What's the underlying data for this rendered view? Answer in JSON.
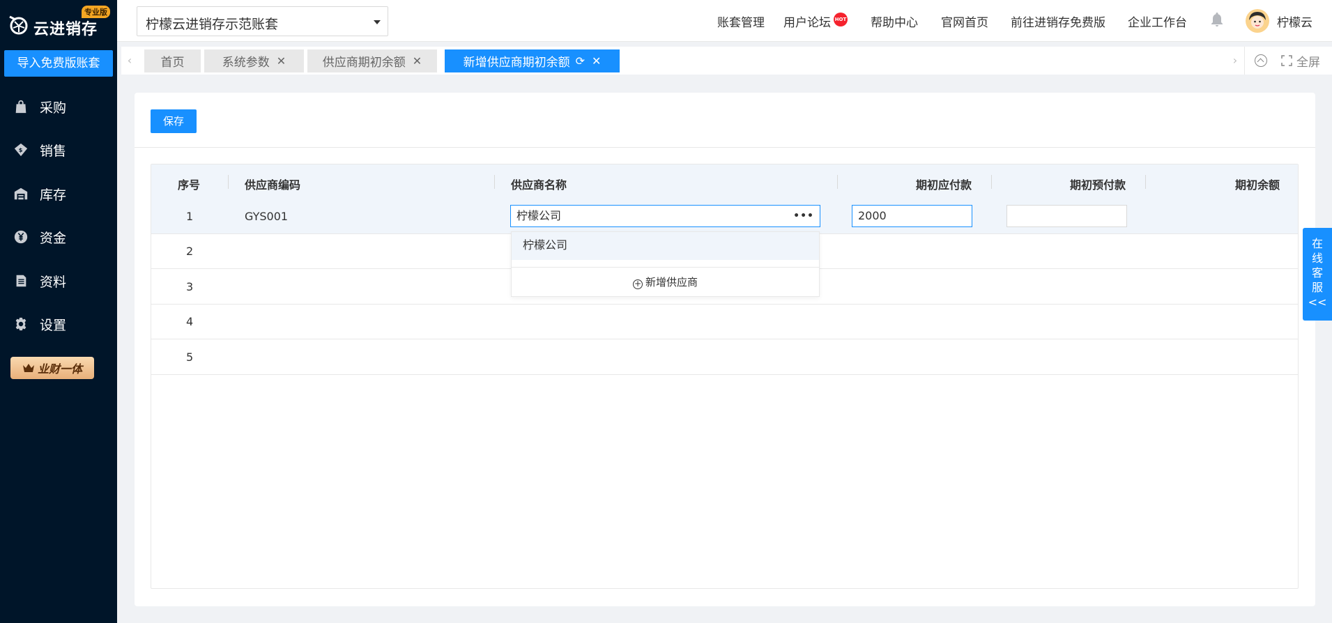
{
  "brand": {
    "logo_text": "云进销存",
    "badge": "专业版"
  },
  "sidebar": {
    "import_button": "导入免费版账套",
    "items": [
      {
        "label": "采购",
        "icon": "bag-icon"
      },
      {
        "label": "销售",
        "icon": "sales-icon"
      },
      {
        "label": "库存",
        "icon": "warehouse-icon"
      },
      {
        "label": "资金",
        "icon": "yen-icon"
      },
      {
        "label": "资料",
        "icon": "document-icon"
      },
      {
        "label": "设置",
        "icon": "gear-icon"
      }
    ],
    "promo": "业财一体"
  },
  "header": {
    "account_value": "柠檬云进销存示范账套",
    "links": [
      "账套管理",
      "用户论坛",
      "帮助中心",
      "官网首页",
      "前往进销存免费版",
      "企业工作台"
    ],
    "hot_badge": "HOT",
    "user_name": "柠檬云"
  },
  "tabs": {
    "items": [
      {
        "label": "首页"
      },
      {
        "label": "系统参数"
      },
      {
        "label": "供应商期初余额"
      },
      {
        "label": "新增供应商期初余额",
        "active": true
      }
    ],
    "fullscreen_label": "全屏"
  },
  "toolbar": {
    "save_label": "保存"
  },
  "table": {
    "columns": [
      "序号",
      "供应商编码",
      "供应商名称",
      "期初应付款",
      "期初预付款",
      "期初余额"
    ],
    "rows": [
      {
        "index": "1",
        "code": "GYS001",
        "name": "柠檬公司",
        "payable": "2000",
        "prepaid": "",
        "balance": ""
      },
      {
        "index": "2",
        "code": "",
        "name": "",
        "payable": "",
        "prepaid": "",
        "balance": ""
      },
      {
        "index": "3",
        "code": "",
        "name": "",
        "payable": "",
        "prepaid": "",
        "balance": ""
      },
      {
        "index": "4",
        "code": "",
        "name": "",
        "payable": "",
        "prepaid": "",
        "balance": ""
      },
      {
        "index": "5",
        "code": "",
        "name": "",
        "payable": "",
        "prepaid": "",
        "balance": ""
      }
    ]
  },
  "dropdown": {
    "options": [
      "柠檬公司"
    ],
    "add_label": "新增供应商"
  },
  "service": {
    "label_chars": [
      "在",
      "线",
      "客",
      "服"
    ],
    "arrow": "<<"
  },
  "colors": {
    "primary": "#1890ff",
    "sidebar_bg": "#001529",
    "header_row_bg": "#f0f5fb"
  }
}
